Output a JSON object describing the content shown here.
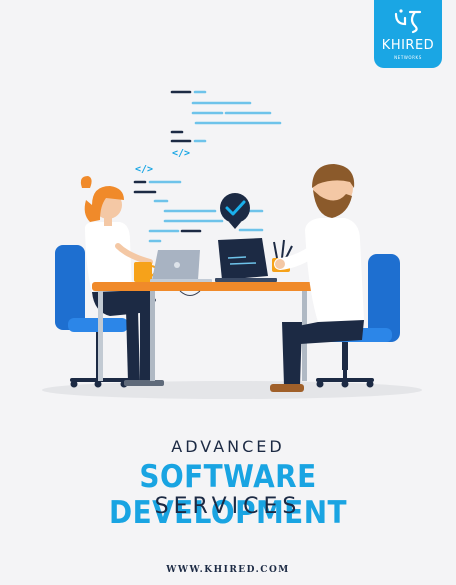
{
  "brand": {
    "name": "KHIRED",
    "tagline": "NETWORKS",
    "logo_icon": "khired-logo-icon",
    "color": "#1aa6e4"
  },
  "illustration": {
    "description_icon": "developers-at-desk-illustration",
    "code_tag": "</>",
    "check_icon": "checkmark-badge-icon"
  },
  "headline": {
    "line1": "ADVANCED",
    "line2": "SOFTWARE DEVELOPMENT",
    "line3": "SERVICES"
  },
  "footer": {
    "website": "WWW.KHIRED.COM"
  },
  "colors": {
    "accent": "#19a4e2",
    "dark": "#1c2a44",
    "background": "#f4f4f6"
  }
}
